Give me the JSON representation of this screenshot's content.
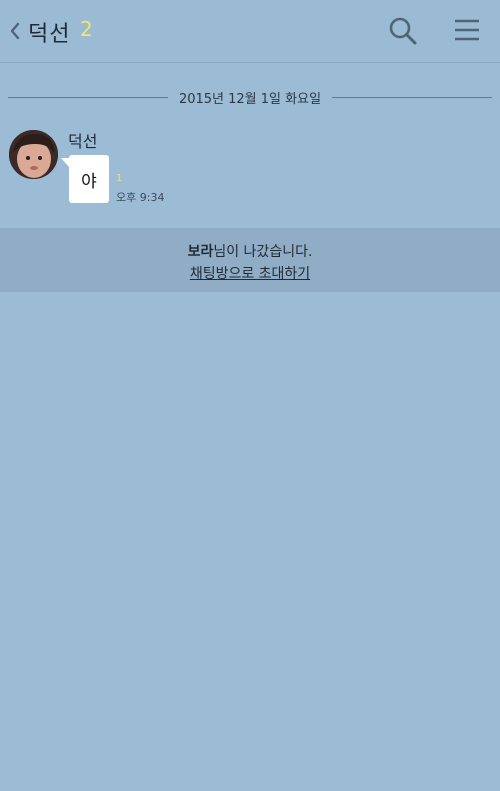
{
  "header": {
    "title": "덕선",
    "member_count": "2",
    "back_icon": "chevron-left-icon",
    "search_icon": "search-icon",
    "menu_icon": "hamburger-menu-icon",
    "accent_color": "#f5e46a"
  },
  "date_divider": {
    "text": "2015년 12월 1일 화요일"
  },
  "messages": [
    {
      "sender": "덕선",
      "text": "야",
      "unread": "1",
      "time": "오후 9:34"
    }
  ],
  "notice": {
    "user_name": "보라",
    "left_text": "님이 나갔습니다.",
    "invite_label": "채팅방으로 초대하기"
  },
  "colors": {
    "background": "#9cbbd5",
    "bubble": "#ffffff",
    "unread": "#f2e25c"
  }
}
